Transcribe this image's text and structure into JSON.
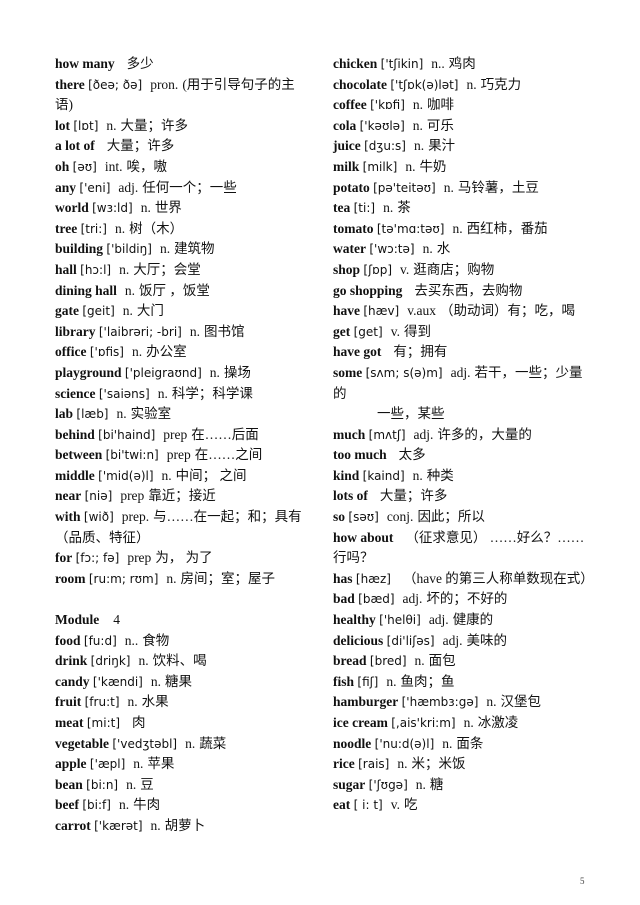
{
  "page_number": "5",
  "left_column": [
    {
      "word": "how many",
      "phonetic": "",
      "pos": "",
      "def": "多少"
    },
    {
      "word": "there",
      "phonetic": "[ðeə; ðə]",
      "pos": "pron.",
      "def": "(用于引导句子的主语)"
    },
    {
      "word": "lot",
      "phonetic": "[lɒt]",
      "pos": "n.",
      "def": "大量；许多"
    },
    {
      "word": "a lot of",
      "phonetic": "",
      "pos": "",
      "def": "大量；许多"
    },
    {
      "word": "oh",
      "phonetic": "[əʊ]",
      "pos": "int.",
      "def": "唉，嗷"
    },
    {
      "word": "any",
      "phonetic": "['eni]",
      "pos": "adj.",
      "def": "任何一个；一些"
    },
    {
      "word": "world",
      "phonetic": "[wɜ:ld]",
      "pos": "n.",
      "def": "世界"
    },
    {
      "word": "tree",
      "phonetic": "[tri:]",
      "pos": "n.",
      "def": "树（木）"
    },
    {
      "word": "building",
      "phonetic": "['bildiŋ]",
      "pos": "n.",
      "def": "建筑物"
    },
    {
      "word": "hall",
      "phonetic": "[hɔ:l]",
      "pos": "n.",
      "def": "大厅；会堂"
    },
    {
      "word": "dining hall",
      "phonetic": "",
      "pos": "n.",
      "def": "饭厅 ，饭堂"
    },
    {
      "word": "gate",
      "phonetic": "[geit]",
      "pos": "n.",
      "def": "大门"
    },
    {
      "word": "library",
      "phonetic": "['laibrəri; -bri]",
      "pos": "n.",
      "def": "图书馆"
    },
    {
      "word": "office",
      "phonetic": "['ɒfis]",
      "pos": "n.",
      "def": "办公室"
    },
    {
      "word": "playground",
      "phonetic": "['pleigraʊnd]",
      "pos": "n.",
      "def": "操场"
    },
    {
      "word": "science",
      "phonetic": "['saiəns]",
      "pos": "n.",
      "def": "科学；科学课"
    },
    {
      "word": "lab",
      "phonetic": "[læb]",
      "pos": "n.",
      "def": "实验室"
    },
    {
      "word": "behind",
      "phonetic": "[bi'haind]",
      "pos": "prep",
      "def": "在……后面"
    },
    {
      "word": "between",
      "phonetic": "[bi'twi:n]",
      "pos": "prep",
      "def": "在……之间"
    },
    {
      "word": "middle",
      "phonetic": "['mid(ə)l]",
      "pos": "n.",
      "def": "中间； 之间"
    },
    {
      "word": "near",
      "phonetic": "[niə]",
      "pos": "prep",
      "def": "靠近；接近"
    },
    {
      "word": "with",
      "phonetic": "[wið]",
      "pos": "prep.",
      "def": "与……在一起；和；具有（品质、特征）"
    },
    {
      "word": "for",
      "phonetic": "[fɔ:; fə]",
      "pos": "prep",
      "def": "为， 为了"
    },
    {
      "word": "room",
      "phonetic": "[ru:m; rʊm]",
      "pos": "n.",
      "def": "房间；室；屋子"
    }
  ],
  "module_heading": {
    "label": "Module",
    "number": "4"
  },
  "left_column_module": [
    {
      "word": "food",
      "phonetic": "[fu:d]",
      "pos": "n..",
      "def": "食物"
    },
    {
      "word": "drink",
      "phonetic": "[driŋk]",
      "pos": "n.",
      "def": "饮料、喝"
    },
    {
      "word": "candy",
      "phonetic": "['kændi]",
      "pos": "n.",
      "def": "糖果"
    },
    {
      "word": "fruit",
      "phonetic": "[fru:t]",
      "pos": "n.",
      "def": "水果"
    },
    {
      "word": "meat",
      "phonetic": "[mi:t]",
      "pos": "",
      "def": "肉"
    },
    {
      "word": "vegetable",
      "phonetic": "['vedʒtəbl]",
      "pos": "n.",
      "def": "蔬菜"
    },
    {
      "word": "apple",
      "phonetic": "['æpl]",
      "pos": "n.",
      "def": "苹果"
    },
    {
      "word": "bean",
      "phonetic": "[bi:n]",
      "pos": "n.",
      "def": "豆"
    },
    {
      "word": "beef",
      "phonetic": "[bi:f]",
      "pos": "n.",
      "def": "牛肉"
    },
    {
      "word": "carrot",
      "phonetic": "['kærət]",
      "pos": "n.",
      "def": "胡萝卜"
    }
  ],
  "right_column": [
    {
      "word": "chicken",
      "phonetic": "['tʃikin]",
      "pos": "n..",
      "def": "鸡肉"
    },
    {
      "word": "chocolate",
      "phonetic": "['tʃɒk(ə)lət]",
      "pos": "n.",
      "def": "巧克力"
    },
    {
      "word": "coffee",
      "phonetic": "['kɒfi]",
      "pos": "n.",
      "def": "咖啡"
    },
    {
      "word": "cola",
      "phonetic": "['kəʊlə]",
      "pos": "n.",
      "def": "可乐"
    },
    {
      "word": "juice",
      "phonetic": "[dʒu:s]",
      "pos": "n.",
      "def": "果汁"
    },
    {
      "word": "milk",
      "phonetic": "[milk]",
      "pos": "n.",
      "def": "牛奶"
    },
    {
      "word": "potato",
      "phonetic": "[pə'teitəʊ]",
      "pos": "n.",
      "def": "马铃薯，土豆"
    },
    {
      "word": "tea",
      "phonetic": "[ti:]",
      "pos": "n.",
      "def": "茶"
    },
    {
      "word": "tomato",
      "phonetic": "[tə'mɑ:təʊ]",
      "pos": "n.",
      "def": "西红柿，番茄"
    },
    {
      "word": "water",
      "phonetic": "['wɔ:tə]",
      "pos": "n.",
      "def": "水"
    },
    {
      "word": "shop",
      "phonetic": "[ʃɒp]",
      "pos": "v.",
      "def": "逛商店；购物"
    },
    {
      "word": "go shopping",
      "phonetic": "",
      "pos": "",
      "def": "去买东西，去购物"
    },
    {
      "word": "have",
      "phonetic": "[hæv]",
      "pos": "v.aux",
      "def": "（助动词）有；吃，喝"
    },
    {
      "word": "get",
      "phonetic": "[get]",
      "pos": "v.",
      "def": "得到"
    },
    {
      "word": "have got",
      "phonetic": "",
      "pos": "",
      "def": "有；拥有"
    },
    {
      "word": "some",
      "phonetic": "[sʌm; s(ə)m]",
      "pos": "adj.",
      "def": "若干，一些；少量的",
      "extra": "一些，某些"
    },
    {
      "word": "much",
      "phonetic": "[mʌtʃ]",
      "pos": "adj.",
      "def": "许多的，大量的"
    },
    {
      "word": "too much",
      "phonetic": "",
      "pos": "",
      "def": "太多"
    },
    {
      "word": "kind",
      "phonetic": "[kaind]",
      "pos": "n.",
      "def": "种类"
    },
    {
      "word": "lots of",
      "phonetic": "",
      "pos": "",
      "def": "大量；许多"
    },
    {
      "word": "so",
      "phonetic": "[səʊ]",
      "pos": "conj.",
      "def": "因此；所以"
    },
    {
      "word": "how about",
      "phonetic": "",
      "pos": "",
      "def": "（征求意见） ……好么？……行吗？"
    },
    {
      "word": "has",
      "phonetic": "[hæz]",
      "pos": "",
      "def": "（have 的第三人称单数现在式）"
    },
    {
      "word": "bad",
      "phonetic": "[bæd]",
      "pos": "adj.",
      "def": "坏的；不好的"
    },
    {
      "word": "healthy",
      "phonetic": "['helθi]",
      "pos": "adj.",
      "def": "健康的"
    },
    {
      "word": "delicious",
      "phonetic": "[di'liʃəs]",
      "pos": "adj.",
      "def": "美味的"
    },
    {
      "word": "bread",
      "phonetic": "[bred]",
      "pos": "n.",
      "def": "面包"
    },
    {
      "word": "fish",
      "phonetic": "[fiʃ]",
      "pos": "n.",
      "def": "鱼肉；鱼"
    },
    {
      "word": "hamburger",
      "phonetic": "['hæmbɜ:gə]",
      "pos": "n.",
      "def": "汉堡包"
    },
    {
      "word": "ice cream",
      "phonetic": "[,ais'kri:m]",
      "pos": "n.",
      "def": "冰激凌"
    },
    {
      "word": "noodle",
      "phonetic": "['nu:d(ə)l]",
      "pos": "n.",
      "def": "面条"
    },
    {
      "word": "rice",
      "phonetic": "[rais]",
      "pos": "n.",
      "def": "米；米饭"
    },
    {
      "word": "sugar",
      "phonetic": "['ʃʊgə]",
      "pos": "n.",
      "def": "糖"
    },
    {
      "word": "eat",
      "phonetic": "[ i: t]",
      "pos": "v.",
      "def": "吃"
    }
  ]
}
